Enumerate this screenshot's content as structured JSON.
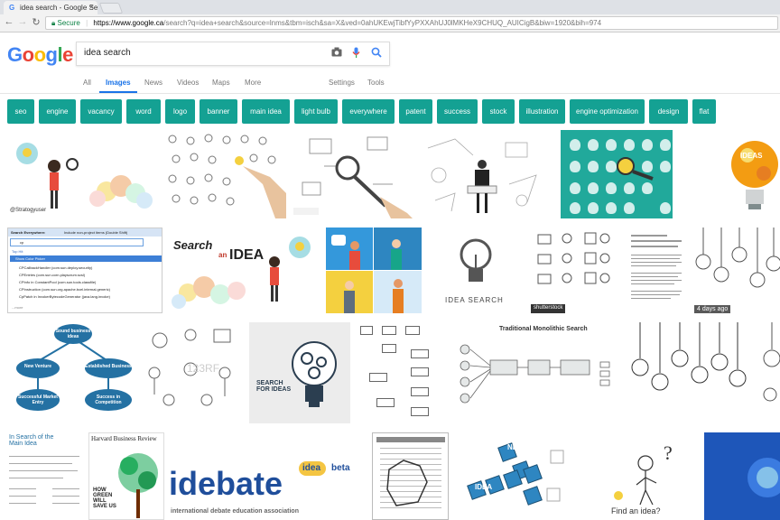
{
  "browser": {
    "tab_title": "idea search - Google Sea",
    "tab_close": "×",
    "secure_label": "Secure",
    "url_domain": "https://www.google.ca",
    "url_path": "/search?q=idea+search&source=lnms&tbm=isch&sa=X&ved=0ahUKEwjTibfYyPXXAhUJ0lMKHeX9CHUQ_AUICigB&biw=1920&bih=974"
  },
  "search": {
    "query": "idea search",
    "camera_icon": "camera-icon",
    "mic_icon": "mic-icon",
    "search_icon": "search-icon"
  },
  "nav_tabs": [
    "All",
    "Images",
    "News",
    "Videos",
    "Maps",
    "More",
    "Settings",
    "Tools"
  ],
  "active_tab": "Images",
  "chips": [
    "seo",
    "engine",
    "vacancy",
    "word",
    "logo",
    "banner",
    "main idea",
    "light bulb",
    "everywhere",
    "patent",
    "success",
    "stock",
    "illustration",
    "engine optimization",
    "design",
    "flat"
  ],
  "accent_colors": {
    "chip": "#14a193",
    "link": "#1a73e8"
  },
  "results": {
    "r1_caption": "@Stratogyuser",
    "r1_ideas": "IDEAS",
    "r2_search_overlay_title": "Search Everywhere:",
    "r2_include_label": "Include non-project items (Double Shift)",
    "r2_query": "cp",
    "r2_top_hit": "Top Hit",
    "r2_show_color_picker": "Show Color Picker",
    "r2_items": [
      "CPCallbackHandler (com.sun.deploy.security)",
      "CPEntries (com.sun.corn.playscrum.scsl)",
      "CPInfo in ConstantPool (com.sun.tools.classfile)",
      "CPInstruction (com.sun.org.apache.bcel.internal.generic)",
      "CpPatch in InvokerBytecodeGenerator (java.lang.invoke)"
    ],
    "r2_more": "...more",
    "r2_search_text": "Search",
    "r2_an_text": "an",
    "r2_idea_text": "IDEA",
    "r2_idea_search_text": "IDEA SEARCH",
    "r2_days_ago": "4 days ago",
    "r2_shutterstock": "shutterstock",
    "r3_sound_business_ideas": "Sound business ideas",
    "r3_new_venture": "New Venture",
    "r3_established_business": "Established Business",
    "r3_successful_market_entry": "Successful Market Entry",
    "r3_success_in_competition": "Success in Competition",
    "r3_search_for_ideas": "SEARCH FOR IDEAS",
    "r3_traditional_monolithic_search": "Traditional Monolithic Search",
    "r3_watermark": "123RF",
    "r4_in_search_main_idea": "In Search of the Main Idea",
    "r4_hbr": "Harvard Business Review",
    "r4_how_green": "HOW GREEN WILL SAVE US",
    "r4_idebate": "idebate",
    "r4_idea_beta_1": "idea",
    "r4_idea_beta_2": "beta",
    "r4_idebate_sub": "international debate education association",
    "r4_new_word": "NEW",
    "r4_idea_word": "IDEA",
    "r4_find_an_idea": "Find an idea?"
  }
}
